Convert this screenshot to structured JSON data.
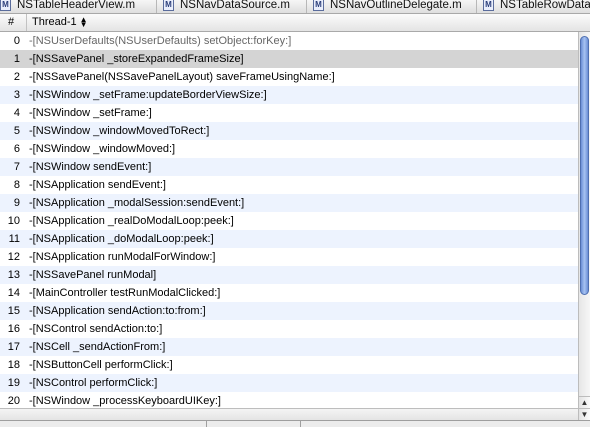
{
  "file_tabs": [
    {
      "label": "NSTableHeaderView.m",
      "icon": "m-file-icon"
    },
    {
      "label": "NSNavDataSource.m",
      "icon": "m-file-icon"
    },
    {
      "label": "NSNavOutlineDelegate.m",
      "icon": "m-file-icon"
    },
    {
      "label": "NSTableRowData",
      "icon": "m-file-icon"
    }
  ],
  "table": {
    "columns": {
      "number": "#",
      "thread": "Thread-1"
    },
    "rows": [
      {
        "num": "0",
        "frame": "-[NSUserDefaults(NSUserDefaults) setObject:forKey:]",
        "dim": true
      },
      {
        "num": "1",
        "frame": "-[NSSavePanel _storeExpandedFrameSize]",
        "selected": true
      },
      {
        "num": "2",
        "frame": "-[NSSavePanel(NSSavePanelLayout) saveFrameUsingName:]"
      },
      {
        "num": "3",
        "frame": "-[NSWindow _setFrame:updateBorderViewSize:]"
      },
      {
        "num": "4",
        "frame": "-[NSWindow _setFrame:]"
      },
      {
        "num": "5",
        "frame": "-[NSWindow _windowMovedToRect:]"
      },
      {
        "num": "6",
        "frame": "-[NSWindow _windowMoved:]"
      },
      {
        "num": "7",
        "frame": "-[NSWindow sendEvent:]"
      },
      {
        "num": "8",
        "frame": "-[NSApplication sendEvent:]"
      },
      {
        "num": "9",
        "frame": "-[NSApplication _modalSession:sendEvent:]"
      },
      {
        "num": "10",
        "frame": "-[NSApplication _realDoModalLoop:peek:]"
      },
      {
        "num": "11",
        "frame": "-[NSApplication _doModalLoop:peek:]"
      },
      {
        "num": "12",
        "frame": "-[NSApplication runModalForWindow:]"
      },
      {
        "num": "13",
        "frame": "-[NSSavePanel runModal]"
      },
      {
        "num": "14",
        "frame": "-[MainController testRunModalClicked:]"
      },
      {
        "num": "15",
        "frame": "-[NSApplication sendAction:to:from:]"
      },
      {
        "num": "16",
        "frame": "-[NSControl sendAction:to:]"
      },
      {
        "num": "17",
        "frame": "-[NSCell _sendActionFrom:]"
      },
      {
        "num": "18",
        "frame": "-[NSButtonCell performClick:]"
      },
      {
        "num": "19",
        "frame": "-[NSControl performClick:]"
      },
      {
        "num": "20",
        "frame": "-[NSWindow _processKeyboardUIKey:]"
      }
    ]
  },
  "colors": {
    "selected_row": "#d4d4d4",
    "alternate_row": "#edf3fe",
    "scroll_thumb": "#6b8fd6"
  }
}
